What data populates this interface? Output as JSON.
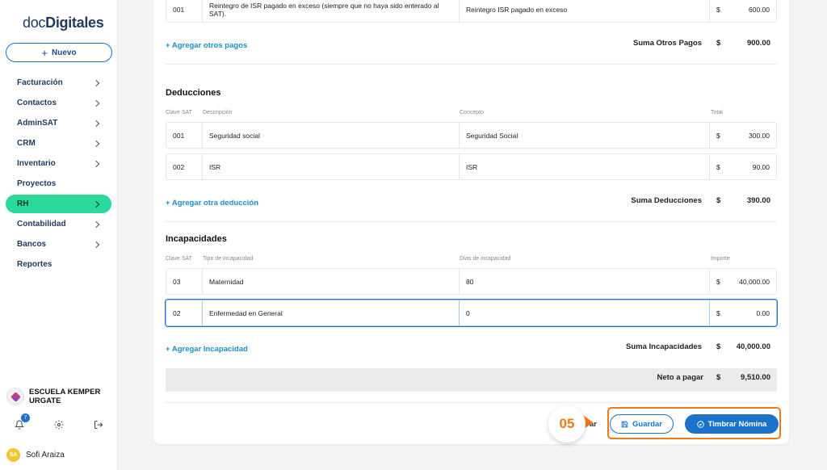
{
  "brand": {
    "part1": "doc",
    "part2": "Digitales"
  },
  "sidebar": {
    "new_button": "Nuevo",
    "items": [
      {
        "label": "Facturación",
        "chevron": true
      },
      {
        "label": "Contactos",
        "chevron": true
      },
      {
        "label": "AdminSAT",
        "chevron": true
      },
      {
        "label": "CRM",
        "chevron": true
      },
      {
        "label": "Inventario",
        "chevron": true
      },
      {
        "label": "Proyectos",
        "chevron": false
      },
      {
        "label": "RH",
        "chevron": true,
        "active": true
      },
      {
        "label": "Contabilidad",
        "chevron": true
      },
      {
        "label": "Bancos",
        "chevron": true
      },
      {
        "label": "Reportes",
        "chevron": false
      }
    ],
    "organization": "ESCUELA KEMPER URGATE",
    "notification_count": "7",
    "user": {
      "initials": "SA",
      "name": "Sofi Araiza"
    }
  },
  "otros_pagos": {
    "rows": [
      {
        "clave": "001",
        "descripcion": "Reintegro de ISR pagado en exceso (siempre que no haya sido enterado al SAT).",
        "concepto": "Reintegro ISR pagado en exceso",
        "currency": "$",
        "total": "600.00"
      }
    ],
    "add_link": "+ Agregar otros pagos",
    "sum_label": "Suma Otros Pagos",
    "sum_currency": "$",
    "sum_value": "900.00"
  },
  "deducciones": {
    "title": "Deducciones",
    "headers": {
      "clave": "Clave SAT",
      "descripcion": "Descripción",
      "concepto": "Concepto",
      "total": "Total"
    },
    "rows": [
      {
        "clave": "001",
        "descripcion": "Seguridad social",
        "concepto": "Seguridad Social",
        "currency": "$",
        "total": "300.00"
      },
      {
        "clave": "002",
        "descripcion": "ISR",
        "concepto": "ISR",
        "currency": "$",
        "total": "90.00"
      }
    ],
    "add_link": "+ Agregar otra deducción",
    "sum_label": "Suma Deducciones",
    "sum_currency": "$",
    "sum_value": "390.00"
  },
  "incapacidades": {
    "title": "Incapacidades",
    "headers": {
      "clave": "Clave SAT",
      "tipo": "Tipo de incapacidad",
      "dias": "Días de incapacidad",
      "importe": "Importe"
    },
    "rows": [
      {
        "clave": "03",
        "tipo": "Maternidad",
        "dias": "80",
        "currency": "$",
        "importe": "40,000.00"
      },
      {
        "clave": "02",
        "tipo": "Enfermedad en General",
        "dias_placeholder": "0",
        "currency": "$",
        "importe": "0.00"
      }
    ],
    "add_link": "+ Agregar Incapacidad",
    "sum_label": "Suma Incapacidades",
    "sum_currency": "$",
    "sum_value": "40,000.00"
  },
  "neto": {
    "label": "Neto a pagar",
    "currency": "$",
    "value": "9,510.00"
  },
  "actions": {
    "cancel_fragment": "ar",
    "guardar": "Guardar",
    "timbrar": "Timbrar Nómina",
    "step_marker": "05"
  },
  "colors": {
    "accent": "#1a73c9",
    "active_nav": "#2bd99a",
    "highlight": "#ee7a1a"
  }
}
